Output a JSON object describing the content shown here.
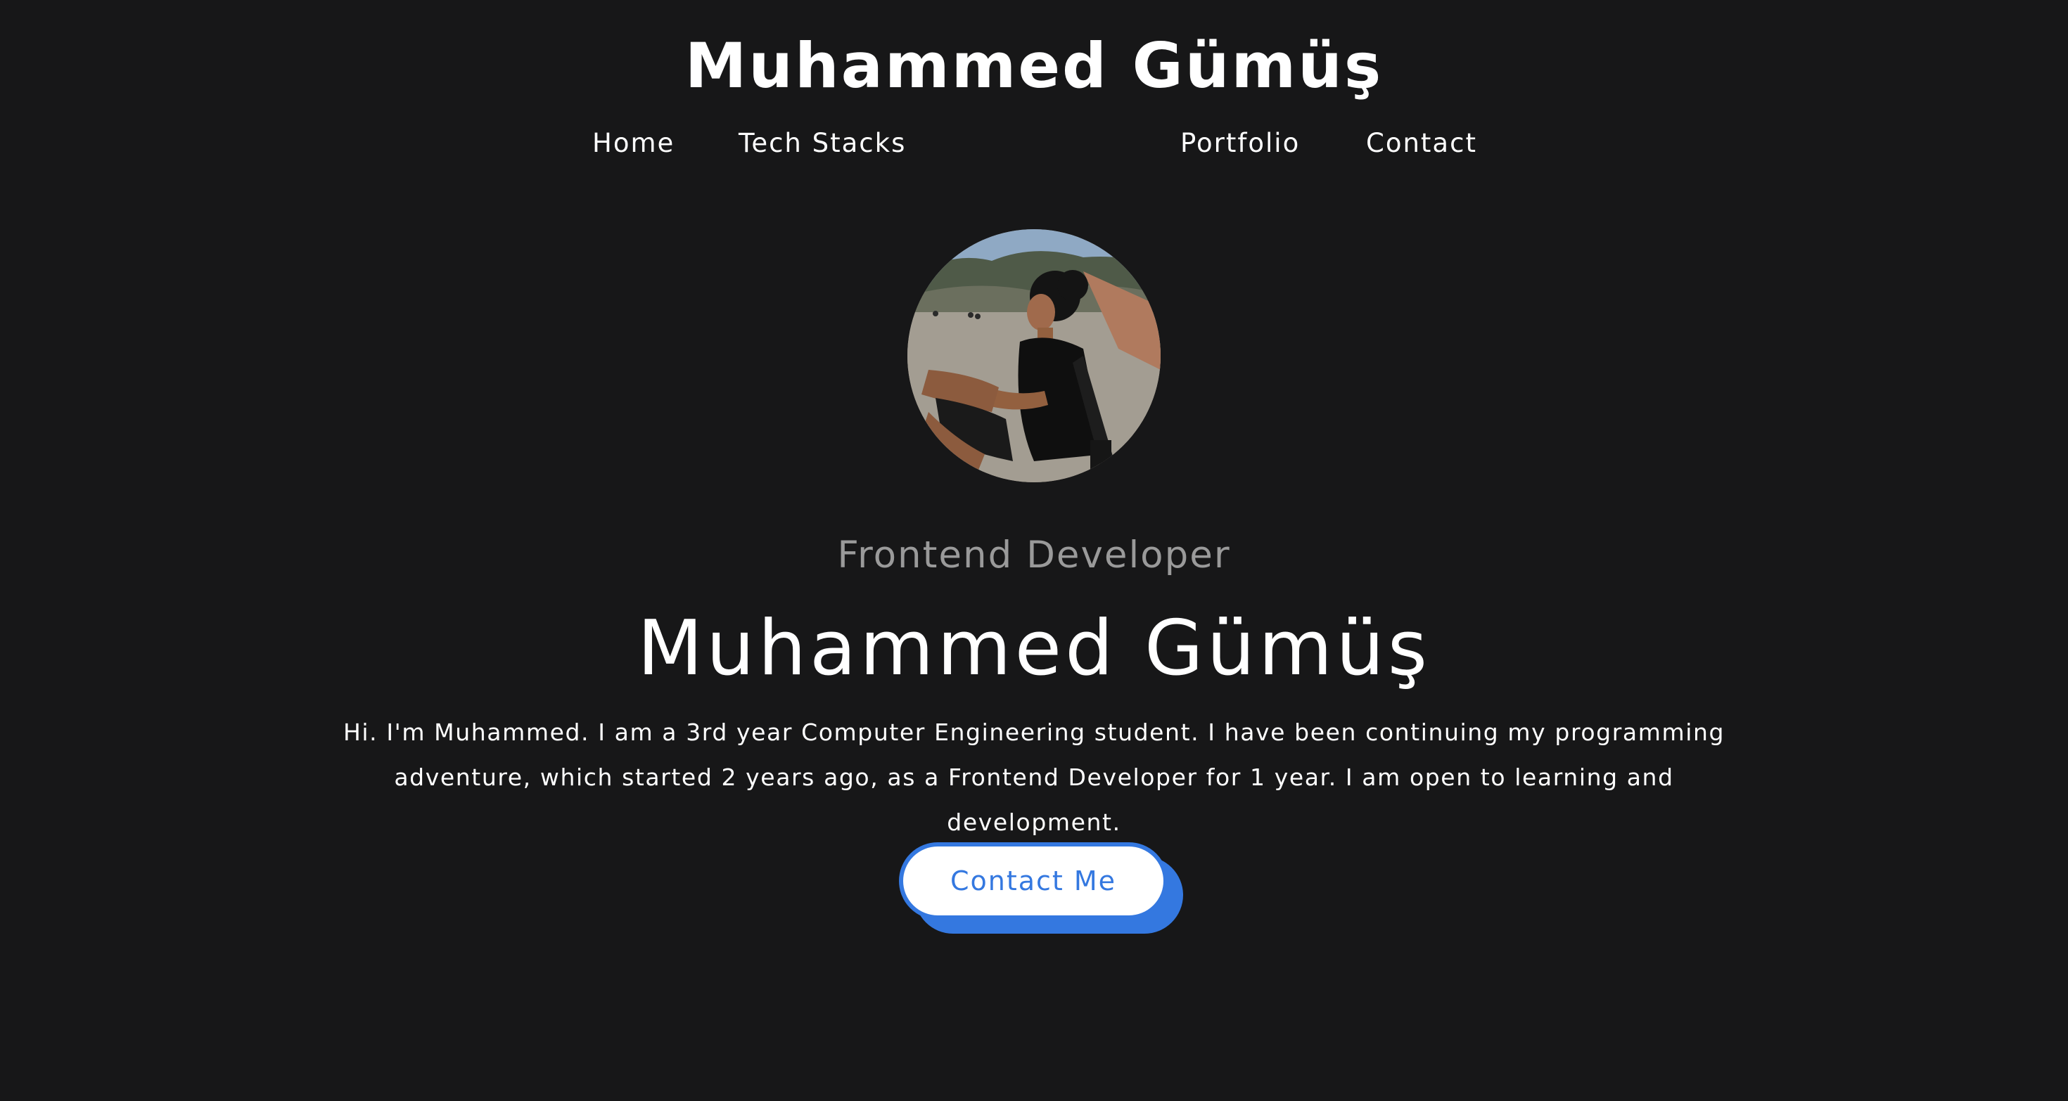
{
  "header": {
    "site_title": "Muhammed Gümüş",
    "nav": [
      {
        "label": "Home"
      },
      {
        "label": "Tech Stacks"
      },
      {
        "label": "Portfolio"
      },
      {
        "label": "Contact"
      }
    ]
  },
  "hero": {
    "avatar_icon": "profile-photo",
    "role": "Frontend Developer",
    "name": "Muhammed Gümüş",
    "bio": "Hi. I'm Muhammed. I am a 3rd year Computer Engineering student. I have been continuing my programming adventure, which started 2 years ago, as a Frontend Developer for 1 year. I am open to learning and development.",
    "contact_button_label": "Contact Me"
  },
  "colors": {
    "background": "#171718",
    "accent": "#3478e0",
    "text": "#ffffff",
    "muted_text": "#9a9a9a"
  }
}
